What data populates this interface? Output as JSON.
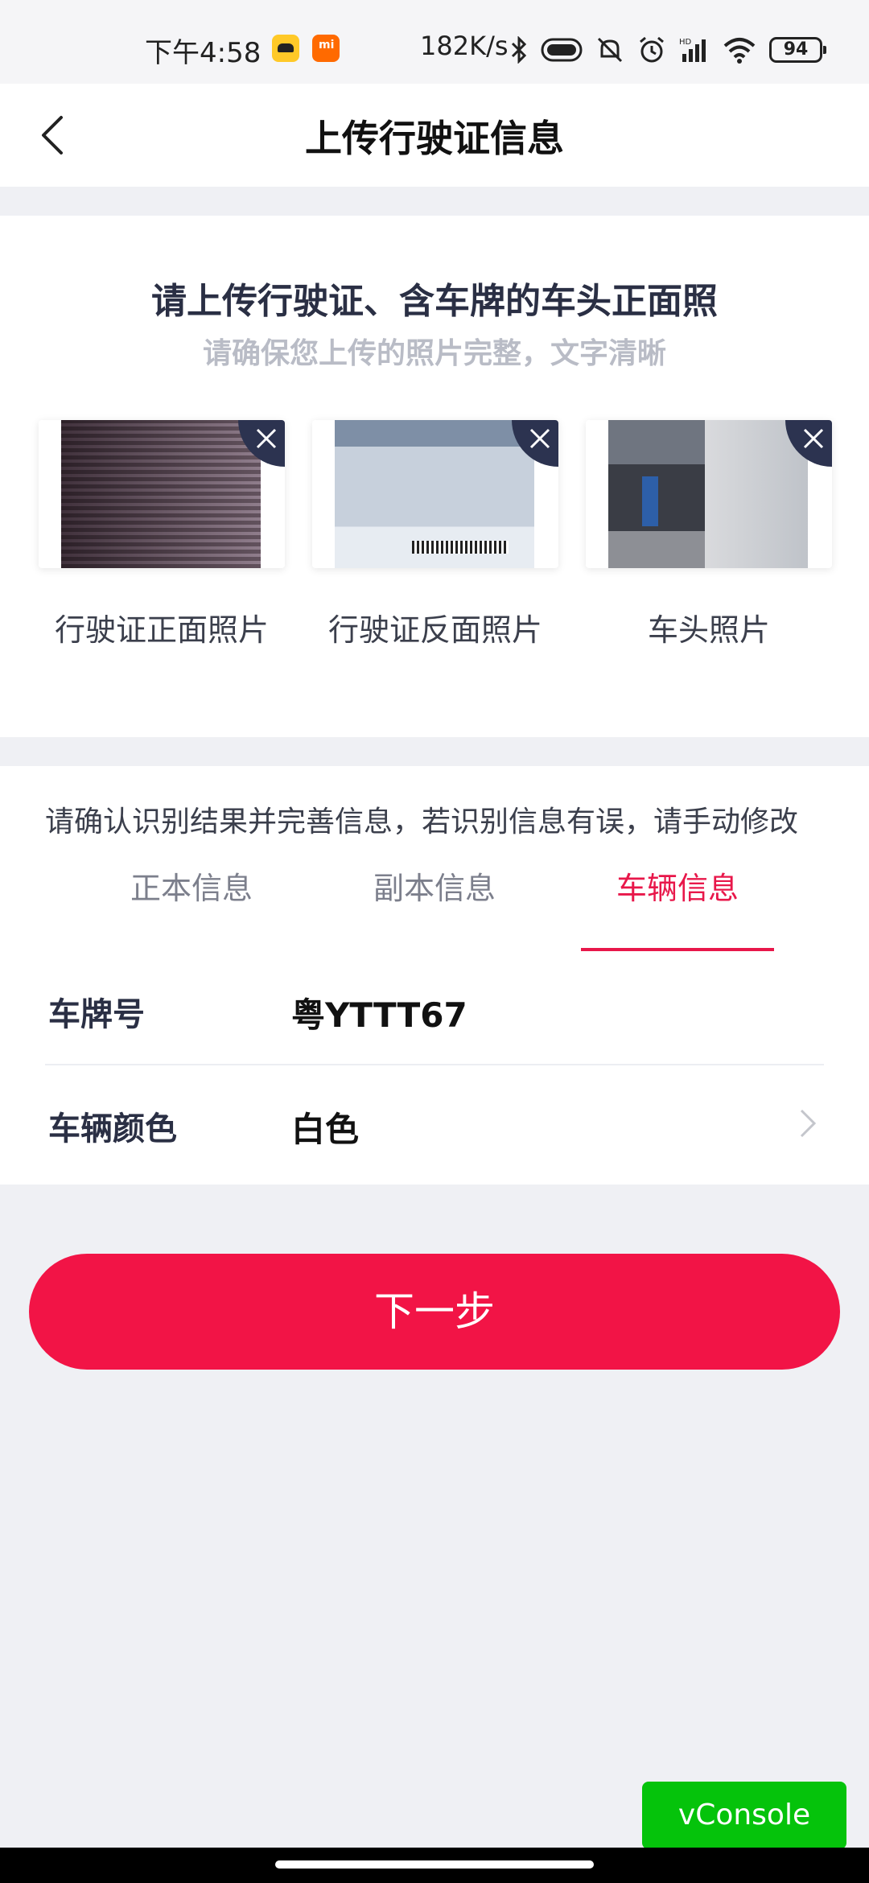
{
  "status_bar": {
    "time": "下午4:58",
    "speed": "182K/s",
    "battery": "94",
    "icons": [
      "car-app-icon",
      "mi-app-icon",
      "bluetooth-icon",
      "toggle-icon",
      "mute-icon",
      "alarm-icon",
      "signal-icon",
      "wifi-icon",
      "battery-icon"
    ]
  },
  "header": {
    "title": "上传行驶证信息",
    "back_icon": "chevron-left-icon"
  },
  "upload": {
    "title": "请上传行驶证、含车牌的车头正面照",
    "subtitle": "请确保您上传的照片完整，文字清晰",
    "photos": [
      {
        "label": "行驶证正面照片"
      },
      {
        "label": "行驶证反面照片"
      },
      {
        "label": "车头照片"
      }
    ]
  },
  "confirm": {
    "note": "请确认识别结果并完善信息，若识别信息有误，请手动修改",
    "tabs": [
      {
        "label": "正本信息",
        "active": false
      },
      {
        "label": "副本信息",
        "active": false
      },
      {
        "label": "车辆信息",
        "active": true
      }
    ],
    "fields": [
      {
        "label": "车牌号",
        "value": "粤YTTT67"
      },
      {
        "label": "车辆颜色",
        "value": "白色"
      }
    ]
  },
  "next_button": "下一步",
  "vconsole": "vConsole",
  "colors": {
    "accent": "#f21446",
    "tab_active": "#e8174a",
    "vconsole": "#05c30b"
  }
}
